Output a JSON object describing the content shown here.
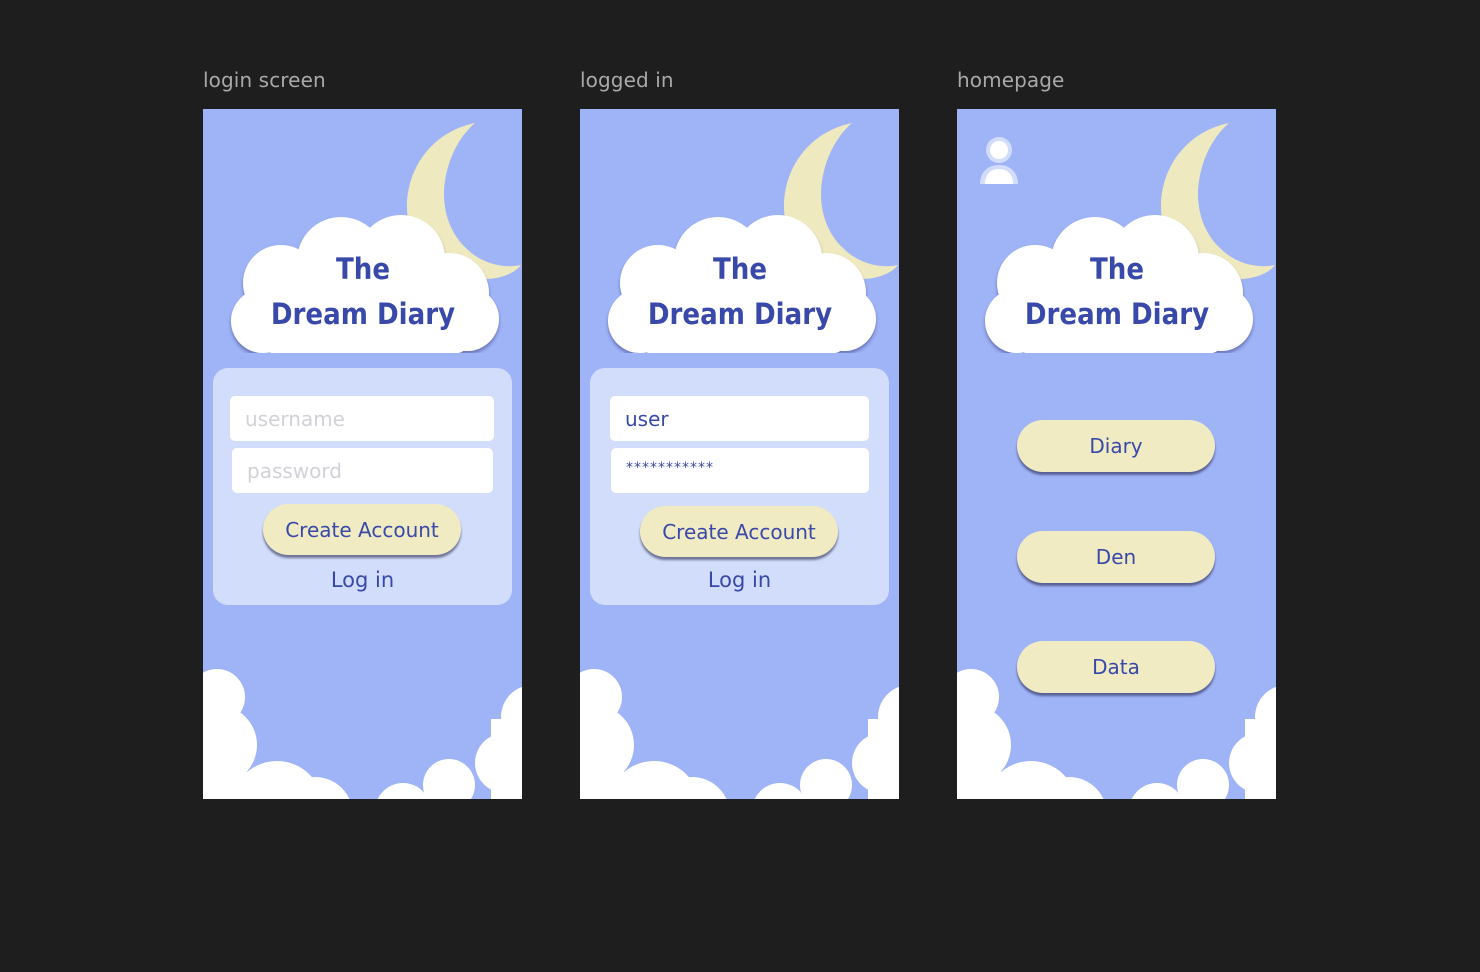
{
  "canvas": {
    "background": "#1e1e1e"
  },
  "theme": {
    "sky": "#9fb3f7",
    "panel": "#d1ddfa",
    "cloud": "#ffffff",
    "moon": "#efe9bf",
    "button": "#f0ebc3",
    "text_primary": "#3949a9",
    "placeholder": "#d1d1d8",
    "frame_label": "#a9a9a9"
  },
  "frames": [
    {
      "label": "login screen",
      "title_line1": "The",
      "title_line2": "Dream Diary",
      "username_placeholder": "username",
      "password_placeholder": "password",
      "create_account_label": "Create Account",
      "login_label": "Log in"
    },
    {
      "label": "logged in",
      "title_line1": "The",
      "title_line2": "Dream Diary",
      "username_value": "user",
      "password_display": "***********",
      "create_account_label": "Create Account",
      "login_label": "Log in"
    },
    {
      "label": "homepage",
      "title_line1": "The",
      "title_line2": "Dream Diary",
      "nav_buttons": [
        "Diary",
        "Den",
        "Data"
      ]
    }
  ],
  "icons": [
    "moon-icon",
    "cloud-icon",
    "profile-icon"
  ]
}
